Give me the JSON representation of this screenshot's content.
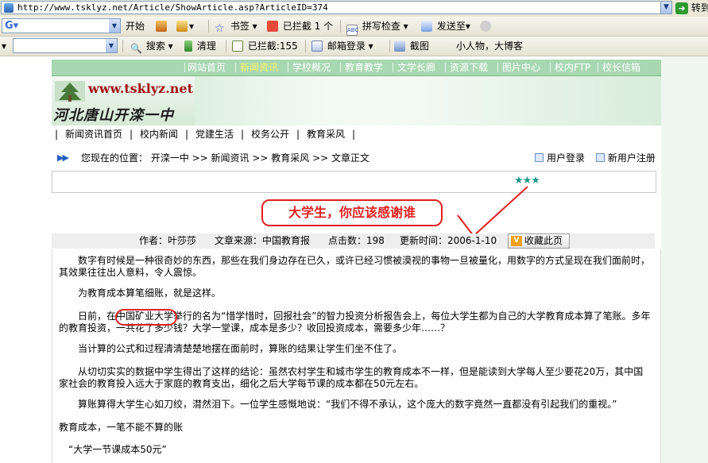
{
  "browser": {
    "url": "http://www.tsklyz.net/Article/ShowArticle.asp?ArticleID=374",
    "go_label": "转到",
    "toolbar1": {
      "search_label": "开始",
      "bookmark_label": "书签",
      "blocked_label": "已拦截 1 个",
      "spell_label": "拼写检查",
      "send_label": "发送至"
    },
    "toolbar2": {
      "search_label": "搜索",
      "clean_label": "清理",
      "blocked_label": "已拦截:155",
      "mail_label": "邮箱登录",
      "capture_label": "截图",
      "slogan": "小人物，大博客"
    }
  },
  "site": {
    "topnav": [
      "网站首页",
      "新闻资讯",
      "学校概况",
      "教育教学",
      "文学长廊",
      "资源下载",
      "图片中心",
      "校内FTP",
      "校长信箱"
    ],
    "active_nav": "新闻资讯",
    "banner_url": "www.tsklyz.net",
    "banner_school": "河北唐山开滦一中",
    "subnav": [
      "新闻资讯首页",
      "校内新闻",
      "党建生活",
      "校务公开",
      "教育采风"
    ],
    "subnav_sep": "|",
    "breadcrumb": "您现在的位置： 开滦一中 >> 新闻资讯 >> 教育采风 >> 文章正文",
    "login_label": "用户登录",
    "register_label": "新用户注册"
  },
  "article": {
    "rating": "★★★",
    "title": "大学生，你应该感谢谁",
    "author": "作者：叶莎莎",
    "source": "文章来源：中国教育报",
    "hits": "点击数：198",
    "updated": "更新时间：2006-1-10",
    "favorite_label": "收藏此页",
    "paragraphs": [
      "　　数字有时候是一种很奇妙的东西，那些在我们身边存在已久，或许已经习惯被漠视的事物一旦被量化，用数字的方式呈现在我们面前时，其效果往往出人意料，令人震惊。",
      "　　为教育成本算笔细账，就是这样。",
      "　　日前，在中国矿业大学举行的名为“惜学惜时，回报社会”的智力投资分析报告会上，每位大学生都为自己的大学教育成本算了笔账。多年的教育投资，一共花了多少钱？大学一堂课，成本是多少？收回投资成本，需要多少年……？",
      "　　当计算的公式和过程清清楚楚地摆在面前时，算账的结果让学生们坐不住了。",
      "　　从切切实实的数据中学生得出了这样的结论：虽然农村学生和城市学生的教育成本不一样，但是能读到大学每人至少要花20万，其中国家社会的教育投入远大于家庭的教育支出，细化之后大学每节课的成本都在50元左右。",
      "　　算账算得大学生心如刀绞，潸然泪下。一位学生感慨地说：“我们不得不承认，这个庞大的数字竟然一直都没有引起我们的重视。”",
      "教育成本，一笔不能不算的账",
      "　“大学一节课成本50元”"
    ]
  },
  "colors": {
    "nav_bg": "#a8d8b2",
    "nav_active": "#fff36a",
    "annotation_red": "#e02020",
    "star_teal": "#1f9a8a"
  }
}
